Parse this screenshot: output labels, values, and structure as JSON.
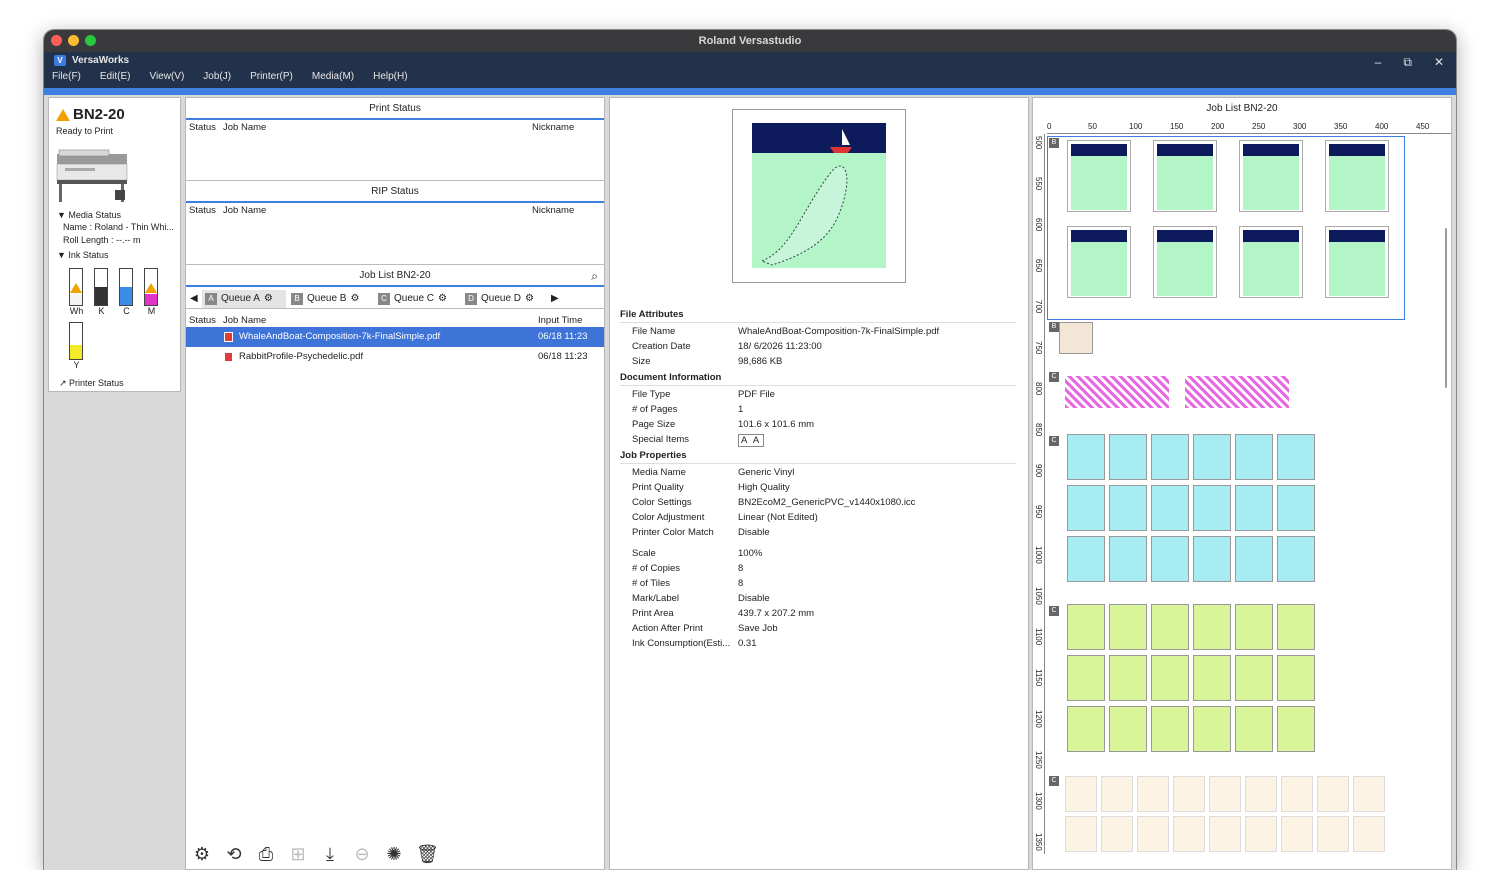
{
  "window": {
    "title": "Roland Versastudio"
  },
  "app": {
    "name": "VersaWorks",
    "logo": "V",
    "menu": [
      "File(F)",
      "Edit(E)",
      "View(V)",
      "Job(J)",
      "Printer(P)",
      "Media(M)",
      "Help(H)"
    ],
    "controls": {
      "minimize": "–",
      "restore": "⧉",
      "close": "✕"
    }
  },
  "printer": {
    "name": "BN2-20",
    "status": "Ready to Print",
    "media_status_label": "Media Status",
    "media_name": "Name : Roland - Thin Whi...",
    "roll_length": "Roll Length : --.-- m",
    "ink_status_label": "Ink Status",
    "inks": [
      {
        "label": "Wh",
        "color": "#f4f4f4",
        "level": 0.3,
        "warning": true
      },
      {
        "label": "K",
        "color": "#333333",
        "level": 0.5,
        "warning": false
      },
      {
        "label": "C",
        "color": "#3b8ee8",
        "level": 0.5,
        "warning": false
      },
      {
        "label": "M",
        "color": "#e035c8",
        "level": 0.3,
        "warning": true
      },
      {
        "label": "Y",
        "color": "#f3ea2a",
        "level": 0.4,
        "warning": false
      }
    ],
    "printer_status_link": "Printer Status"
  },
  "print_status": {
    "title": "Print Status",
    "columns": [
      "Status",
      "Job Name",
      "Nickname"
    ]
  },
  "rip_status": {
    "title": "RIP Status",
    "columns": [
      "Status",
      "Job Name",
      "Nickname"
    ]
  },
  "job_list": {
    "title": "Job List BN2-20",
    "tabs": [
      {
        "letter": "A",
        "label": "Queue A"
      },
      {
        "letter": "B",
        "label": "Queue B"
      },
      {
        "letter": "C",
        "label": "Queue C"
      },
      {
        "letter": "D",
        "label": "Queue D"
      }
    ],
    "columns": [
      "Status",
      "Job Name",
      "Input Time"
    ],
    "rows": [
      {
        "name": "WhaleAndBoat-Composition-7k-FinalSimple.pdf",
        "time": "06/18 11:23",
        "selected": true
      },
      {
        "name": "RabbitProfile-Psychedelic.pdf",
        "time": "06/18 11:23",
        "selected": false
      }
    ],
    "toolbar": [
      "gear-icon",
      "refresh-icon",
      "print-icon",
      "tile-icon",
      "download-icon",
      "cancel-icon",
      "spinner-icon",
      "trash-icon"
    ]
  },
  "attributes": {
    "file_attributes": "File Attributes",
    "file": [
      {
        "k": "File Name",
        "v": "WhaleAndBoat-Composition-7k-FinalSimple.pdf"
      },
      {
        "k": "Creation Date",
        "v": "18/ 6/2026 11:23:00"
      },
      {
        "k": "Size",
        "v": "98,686 KB"
      }
    ],
    "document_information": "Document Information",
    "document": [
      {
        "k": "File Type",
        "v": "PDF File"
      },
      {
        "k": "# of Pages",
        "v": "1"
      },
      {
        "k": "Page Size",
        "v": "101.6 x 101.6 mm"
      },
      {
        "k": "Special Items",
        "v": "A A"
      }
    ],
    "job_properties": "Job Properties",
    "job": [
      {
        "k": "Media Name",
        "v": "Generic Vinyl"
      },
      {
        "k": "Print Quality",
        "v": "High Quality"
      },
      {
        "k": "Color Settings",
        "v": "BN2EcoM2_GenericPVC_v1440x1080.icc"
      },
      {
        "k": "Color Adjustment",
        "v": "Linear (Not Edited)"
      },
      {
        "k": "Printer Color Match",
        "v": "Disable"
      }
    ],
    "job2": [
      {
        "k": "Scale",
        "v": "100%"
      },
      {
        "k": "# of Copies",
        "v": "8"
      },
      {
        "k": "# of Tiles",
        "v": "8"
      },
      {
        "k": "Mark/Label",
        "v": "Disable"
      },
      {
        "k": "Print Area",
        "v": "439.7 x 207.2 mm"
      },
      {
        "k": "Action After Print",
        "v": "Save Job"
      },
      {
        "k": "Ink Consumption(Esti...",
        "v": "0.31"
      }
    ]
  },
  "layout": {
    "title": "Job List BN2-20",
    "ruler_h": [
      "0",
      "50",
      "100",
      "150",
      "200",
      "250",
      "300",
      "350",
      "400",
      "450"
    ],
    "ruler_v": [
      "500",
      "550",
      "600",
      "650",
      "700",
      "750",
      "800",
      "850",
      "900",
      "950",
      "1000",
      "1050",
      "1100",
      "1150",
      "1200",
      "1250",
      "1300",
      "1350"
    ],
    "queue_badges": [
      "B",
      "B",
      "C",
      "C",
      "C",
      "C"
    ]
  }
}
